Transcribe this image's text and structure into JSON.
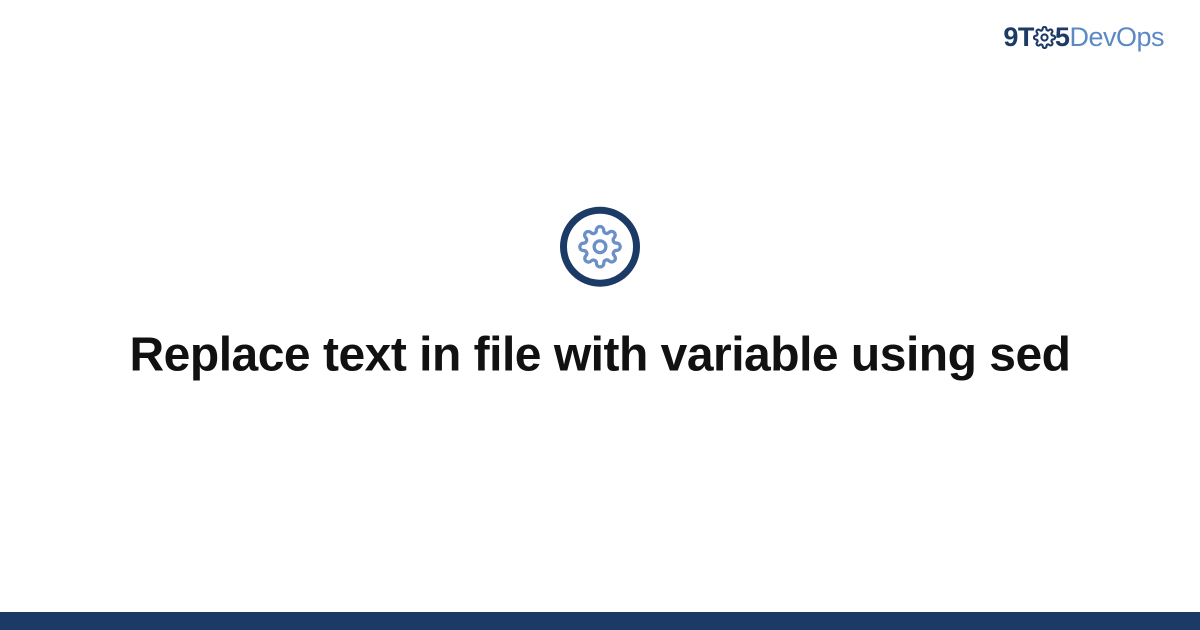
{
  "logo": {
    "nine": "9",
    "t": "T",
    "five": "5",
    "dev": "Dev",
    "ops": "Ops"
  },
  "title": "Replace text in file with variable using sed",
  "colors": {
    "brand_dark": "#1b3a66",
    "brand_light": "#5b89c4"
  }
}
